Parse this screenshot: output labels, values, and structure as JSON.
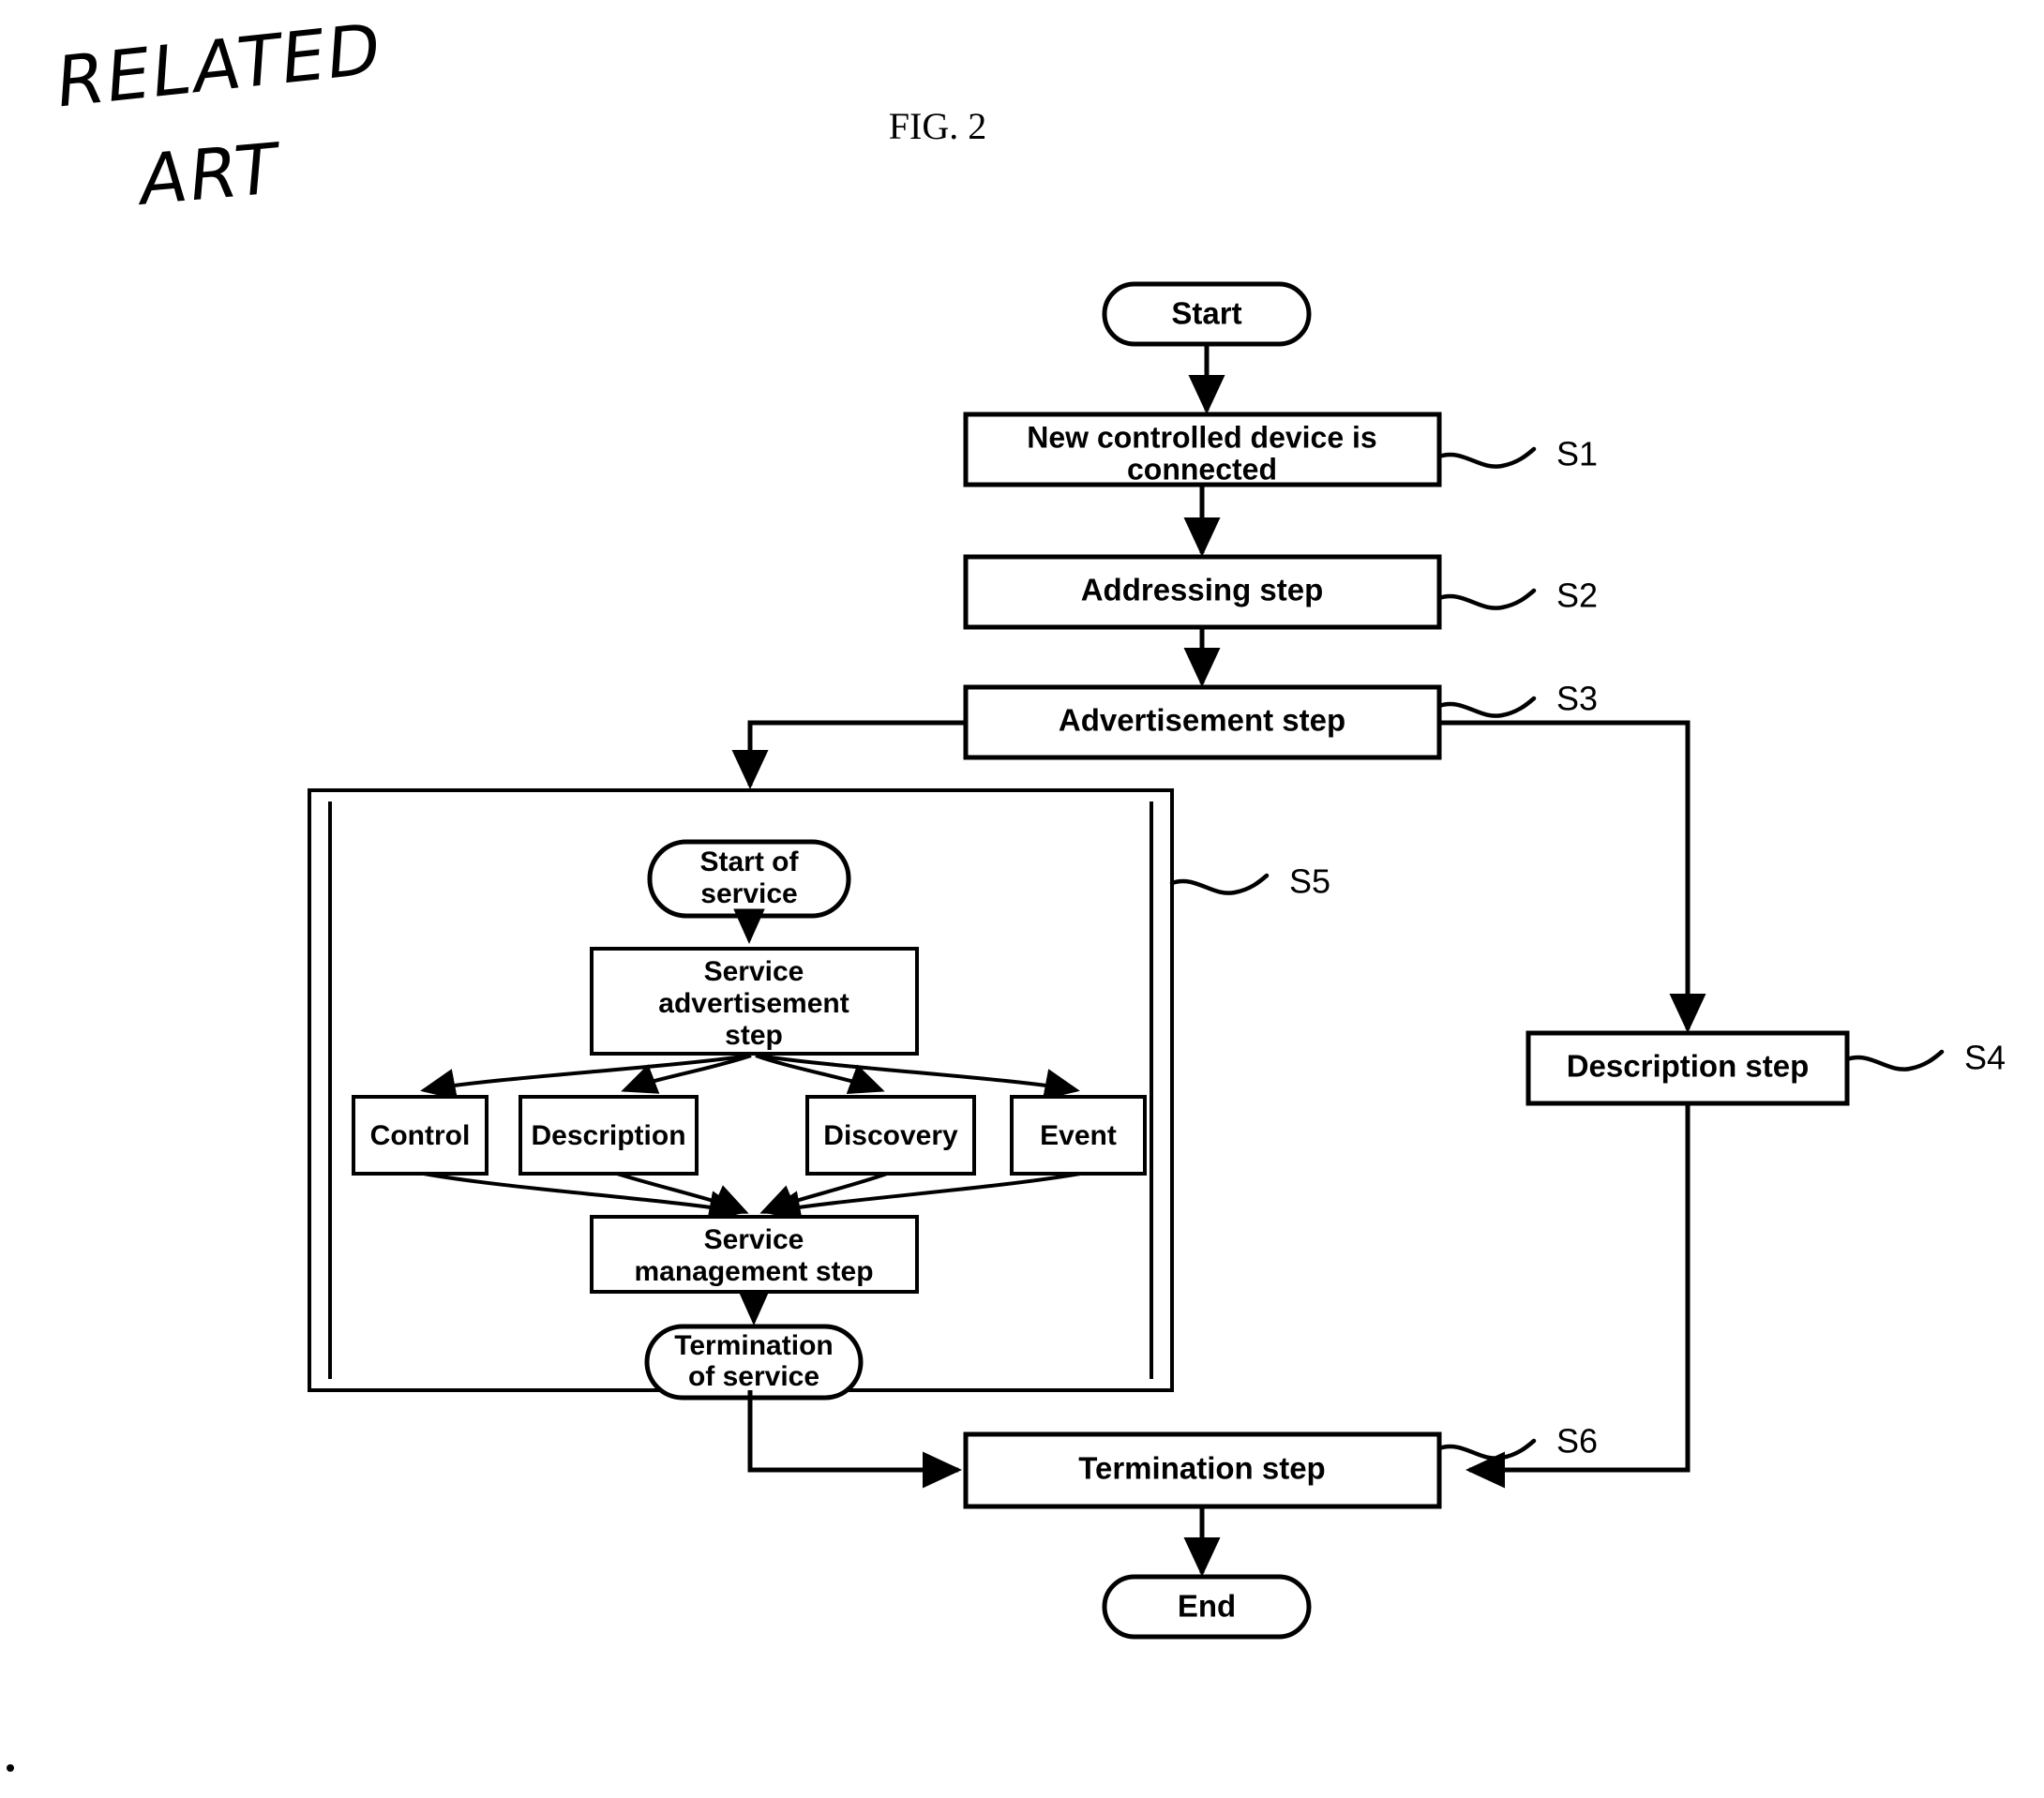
{
  "figure": {
    "title": "FIG. 2",
    "annotation_line1": "RELATED",
    "annotation_line2": "ART"
  },
  "nodes": {
    "start": "Start",
    "s1_line1": "New controlled device is",
    "s1_line2": "connected",
    "s2": "Addressing step",
    "s3": "Advertisement step",
    "s4": "Description step",
    "s6": "Termination step",
    "end": "End",
    "start_of_service_line1": "Start of",
    "start_of_service_line2": "service",
    "service_advertisement_line1": "Service",
    "service_advertisement_line2": "advertisement",
    "service_advertisement_line3": "step",
    "control": "Control",
    "description": "Description",
    "discovery": "Discovery",
    "event": "Event",
    "service_management_line1": "Service",
    "service_management_line2": "management step",
    "termination_of_service_line1": "Termination",
    "termination_of_service_line2": "of service"
  },
  "step_labels": {
    "s1": "S1",
    "s2": "S2",
    "s3": "S3",
    "s4": "S4",
    "s5": "S5",
    "s6": "S6"
  },
  "colors": {
    "ink": "#000000",
    "paper": "#ffffff"
  }
}
